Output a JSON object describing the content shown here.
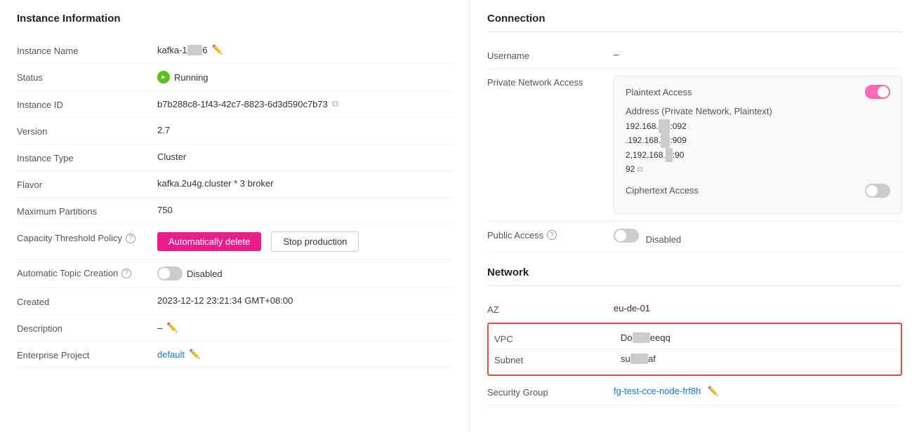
{
  "left": {
    "section_title": "Instance Information",
    "rows": [
      {
        "label": "Instance Name",
        "value": "kafka-1",
        "value_suffix": "6",
        "has_edit": true,
        "type": "name"
      },
      {
        "label": "Status",
        "value": "Running",
        "type": "status"
      },
      {
        "label": "Instance ID",
        "value": "b7b288c8-1f43-42c7-8823-6d3d590c7b73",
        "has_copy": true,
        "type": "id"
      },
      {
        "label": "Version",
        "value": "2.7",
        "type": "text"
      },
      {
        "label": "Instance Type",
        "value": "Cluster",
        "type": "text"
      },
      {
        "label": "Flavor",
        "value": "kafka.2u4g.cluster * 3 broker",
        "type": "text"
      },
      {
        "label": "Maximum Partitions",
        "value": "750",
        "type": "text"
      },
      {
        "label": "Capacity Threshold Policy",
        "btn_auto": "Automatically delete",
        "btn_stop": "Stop production",
        "has_question": true,
        "type": "buttons"
      },
      {
        "label": "Automatic Topic Creation",
        "toggle": "off",
        "toggle_text": "Disabled",
        "has_question": true,
        "type": "toggle"
      },
      {
        "label": "Created",
        "value": "2023-12-12 23:21:34 GMT+08:00",
        "type": "text"
      },
      {
        "label": "Description",
        "value": "–",
        "has_edit": true,
        "type": "text"
      },
      {
        "label": "Enterprise Project",
        "value": "default",
        "has_edit": true,
        "type": "link"
      }
    ]
  },
  "right": {
    "connection": {
      "title": "Connection",
      "username_label": "Username",
      "username_value": "–",
      "private_network_label": "Private Network Access",
      "plaintext_label": "Plaintext Access",
      "address_label": "Address (Private Network, Plaintext)",
      "addresses": [
        "192.168.███████:092",
        ".192.168.███████:909",
        "2,192.168.███:90",
        "92"
      ],
      "ciphertext_label": "Ciphertext Access",
      "public_label": "Public Access",
      "public_disabled": "Disabled"
    },
    "network": {
      "title": "Network",
      "az_label": "AZ",
      "az_value": "eu-de-01",
      "vpc_label": "VPC",
      "vpc_value": "Do███████eeqq",
      "subnet_label": "Subnet",
      "subnet_value": "su███████af",
      "security_label": "Security Group",
      "security_value": "fg-test-cce-node-frf8h"
    }
  }
}
